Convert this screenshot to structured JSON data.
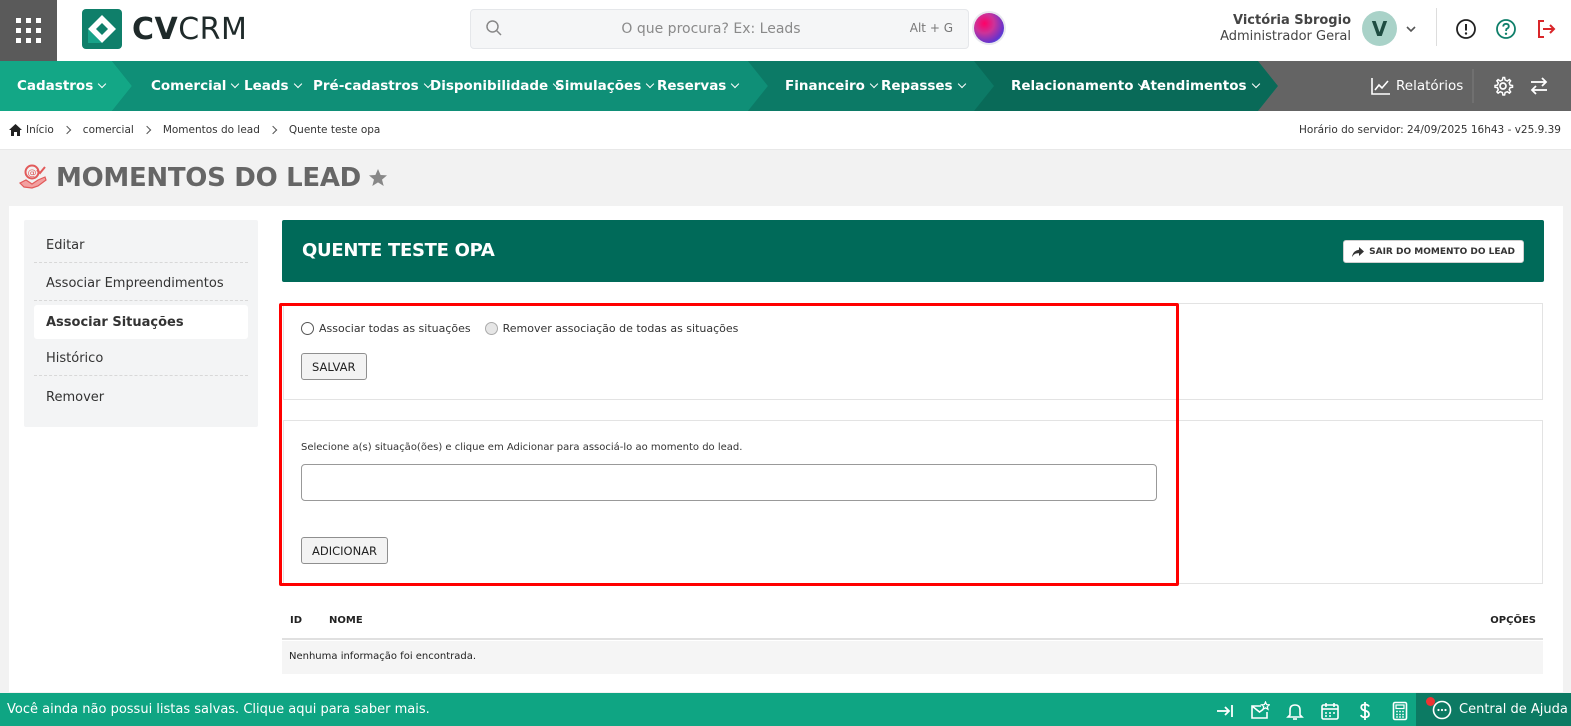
{
  "header": {
    "logo_bold": "CV",
    "logo_light": "CRM",
    "search_placeholder": "O que procura? Ex: Leads",
    "search_shortcut": "Alt + G",
    "user_name": "Victória Sbrogio",
    "user_role": "Administrador Geral",
    "avatar_letter": "V"
  },
  "nav": {
    "items": [
      {
        "label": "Cadastros"
      },
      {
        "label": "Comercial"
      },
      {
        "label": "Leads"
      },
      {
        "label": "Pré-cadastros"
      },
      {
        "label": "Disponibilidade"
      },
      {
        "label": "Simulações"
      },
      {
        "label": "Reservas"
      },
      {
        "label": "Financeiro"
      },
      {
        "label": "Repasses"
      },
      {
        "label": "Relacionamento"
      },
      {
        "label": "Atendimentos"
      }
    ],
    "reports_label": "Relatórios",
    "colors": {
      "seg1": "#13a786",
      "seg2": "#0f8f77",
      "seg3": "#0c7a66",
      "seg4": "#096a58",
      "right": "#646464"
    }
  },
  "breadcrumb": {
    "items": [
      "Início",
      "comercial",
      "Momentos do lead",
      "Quente teste opa"
    ],
    "server_time": "Horário do servidor: 24/09/2025 16h43 - v25.9.39"
  },
  "page": {
    "title": "MOMENTOS DO LEAD"
  },
  "sidebar": {
    "items": [
      {
        "label": "Editar"
      },
      {
        "label": "Associar Empreendimentos"
      },
      {
        "label": "Associar Situações"
      },
      {
        "label": "Histórico"
      },
      {
        "label": "Remover"
      }
    ],
    "active_index": 2
  },
  "lead": {
    "title": "QUENTE TESTE OPA",
    "exit_label": "SAIR DO MOMENTO DO LEAD"
  },
  "form": {
    "radio_all": "Associar todas as situações",
    "radio_remove": "Remover associação de todas as situações",
    "save_label": "SALVAR",
    "instruction": "Selecione a(s) situação(ões) e clique em Adicionar para associá-lo ao momento do lead.",
    "situations_value": "",
    "add_label": "ADICIONAR"
  },
  "table": {
    "columns": [
      "ID",
      "NOME",
      "OPÇÕES"
    ],
    "empty_message": "Nenhuma informação foi encontrada."
  },
  "footer": {
    "message": "Você ainda não possui listas salvas. Clique aqui para saber mais.",
    "help_label": "Central de Ajuda"
  },
  "colors": {
    "brand_green": "#0f7f6a",
    "banner_green": "#006a59",
    "footer_green": "#0fa583",
    "highlight": "#ff0000",
    "logout_red": "#d9262a"
  }
}
